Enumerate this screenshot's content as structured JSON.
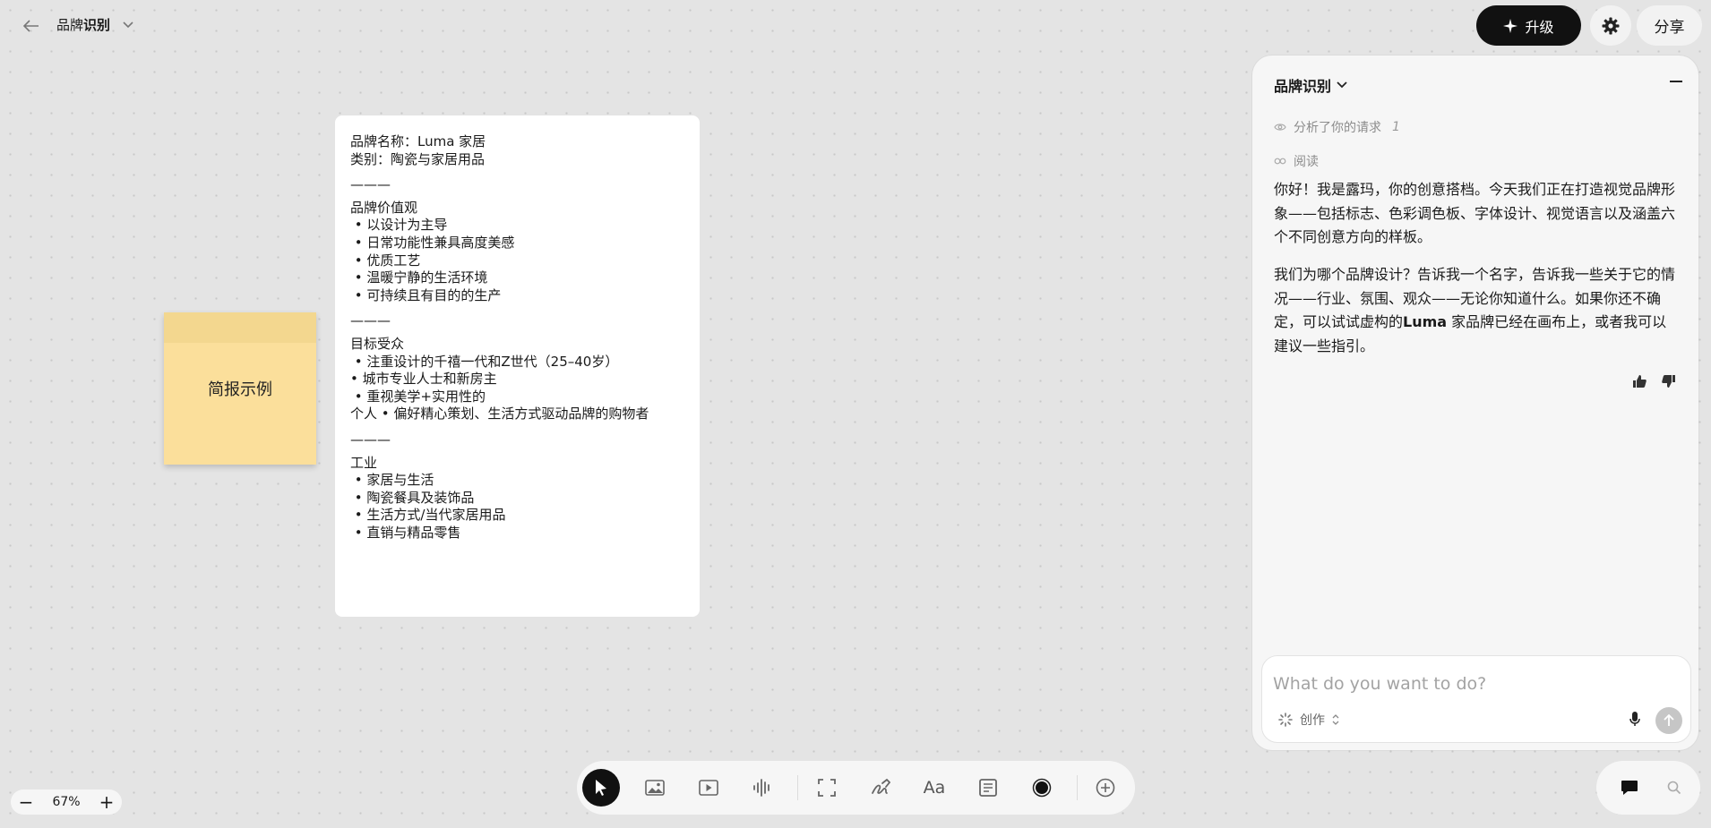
{
  "header": {
    "title_part1": "品牌",
    "title_part2": "识别",
    "upgrade_label": "升级",
    "share_label": "分享"
  },
  "sticky_note": {
    "text": "简报示例"
  },
  "brief": {
    "lines": [
      "品牌名称：Luma 家居",
      "类别：陶瓷与家居用品",
      "———",
      "品牌价值观",
      " • 以设计为主导",
      " • 日常功能性兼具高度美感",
      " • 优质工艺",
      " • 温暖宁静的生活环境",
      " • 可持续且有目的的生产",
      "———",
      "目标受众",
      " • 注重设计的千禧一代和Z世代（25–40岁）",
      "• 城市专业人士和新房主",
      " • 重视美学+实用性的",
      "个人 • 偏好精心策划、生活方式驱动品牌的购物者",
      "———",
      "工业",
      " • 家居与生活",
      " • 陶瓷餐具及装饰品",
      " • 生活方式/当代家居用品",
      " • 直销与精品零售"
    ]
  },
  "panel": {
    "title": "品牌识别",
    "status1": "分析了你的请求",
    "status1_count": "1",
    "status2": "阅读",
    "message1": "你好！我是露玛，你的创意搭档。今天我们正在打造视觉品牌形象——包括标志、色彩调色板、字体设计、视觉语言以及涵盖六个不同创意方向的样板。",
    "message2_a": "我们为哪个品牌设计？告诉我一个名字，告诉我一些关于它的情况——行业、氛围、观众——无论你知道什么。如果你还不确定，可以试试虚构的",
    "message2_b": "Luma",
    "message2_c": " 家品牌已经在画布上，或者我可以建议一些指引。",
    "composer_placeholder": "What do you want to do?",
    "mode_label": "创作"
  },
  "zoom": {
    "minus": "−",
    "level": "67%",
    "plus": "+"
  },
  "toolbar": {
    "text_tool_label": "Aa"
  }
}
